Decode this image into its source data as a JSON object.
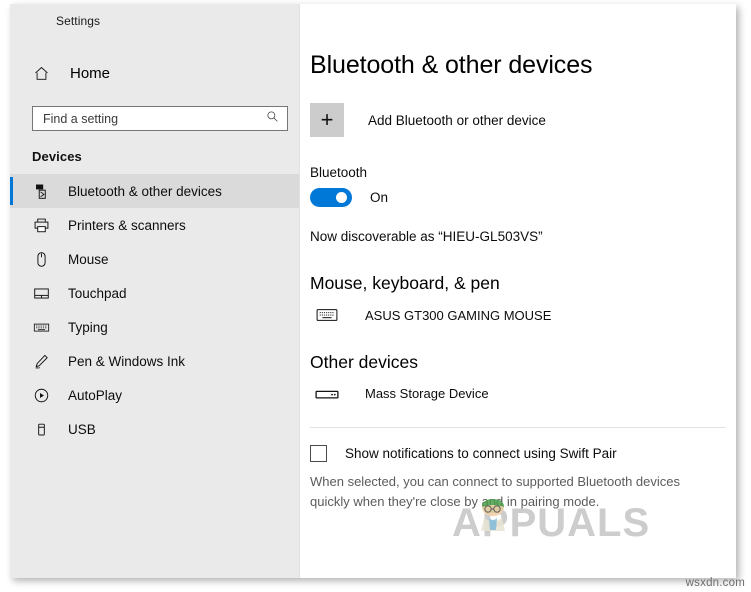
{
  "window": {
    "title": "Settings"
  },
  "sidebar": {
    "home_label": "Home",
    "home_icon": "home-icon",
    "search": {
      "placeholder": "Find a setting",
      "value": "",
      "icon": "search-icon"
    },
    "section_heading": "Devices",
    "items": [
      {
        "label": "Bluetooth & other devices",
        "icon": "bluetooth-devices-icon",
        "selected": true
      },
      {
        "label": "Printers & scanners",
        "icon": "printer-icon",
        "selected": false
      },
      {
        "label": "Mouse",
        "icon": "mouse-icon",
        "selected": false
      },
      {
        "label": "Touchpad",
        "icon": "touchpad-icon",
        "selected": false
      },
      {
        "label": "Typing",
        "icon": "keyboard-icon",
        "selected": false
      },
      {
        "label": "Pen & Windows Ink",
        "icon": "pen-icon",
        "selected": false
      },
      {
        "label": "AutoPlay",
        "icon": "autoplay-icon",
        "selected": false
      },
      {
        "label": "USB",
        "icon": "usb-icon",
        "selected": false
      }
    ]
  },
  "main": {
    "page_title": "Bluetooth & other devices",
    "add_device": {
      "label": "Add Bluetooth or other device",
      "icon": "plus-icon"
    },
    "bluetooth": {
      "label": "Bluetooth",
      "toggle_state": "On",
      "discoverable_text": "Now discoverable as “HIEU-GL503VS”"
    },
    "groups": [
      {
        "title": "Mouse, keyboard, & pen",
        "devices": [
          {
            "name": "ASUS GT300 GAMING MOUSE",
            "icon": "keyboard-device-icon"
          }
        ]
      },
      {
        "title": "Other devices",
        "devices": [
          {
            "name": "Mass Storage Device",
            "icon": "mass-storage-icon"
          }
        ]
      }
    ],
    "swift_pair": {
      "label": "Show notifications to connect using Swift Pair",
      "checked": false,
      "description": "When selected, you can connect to supported Bluetooth devices quickly when they're close by and in pairing mode."
    }
  },
  "overlay": {
    "watermark_text": "APPUALS",
    "corner_credit": "wsxdn.com"
  },
  "colors": {
    "accent": "#0078d7",
    "sidebar_bg": "#eaeaea",
    "content_bg": "#ffffff",
    "watermark": "#cbcbcb"
  }
}
